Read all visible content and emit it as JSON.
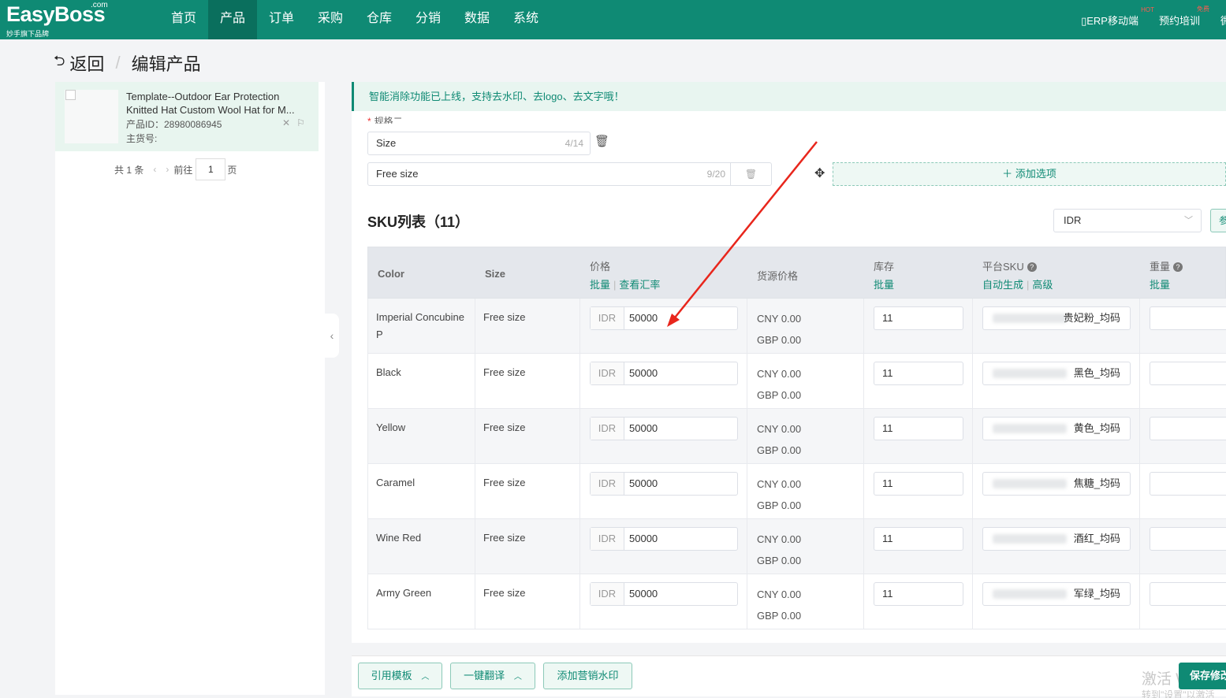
{
  "brand": {
    "name": "EasyBoss",
    "com": ".com",
    "sub": "妙手旗下品牌"
  },
  "nav": [
    {
      "label": "首页",
      "active": false
    },
    {
      "label": "产品",
      "active": true
    },
    {
      "label": "订单",
      "active": false
    },
    {
      "label": "采购",
      "active": false
    },
    {
      "label": "仓库",
      "active": false
    },
    {
      "label": "分销",
      "active": false
    },
    {
      "label": "数据",
      "active": false
    },
    {
      "label": "系统",
      "active": false
    }
  ],
  "top_right": {
    "erp_mobile": "ERP移动端",
    "erp_badge": "HOT",
    "training": "预约培训",
    "training_badge": "免费",
    "edge": "微"
  },
  "header": {
    "back": "返回",
    "sep": "/",
    "title": "编辑产品"
  },
  "left": {
    "product": {
      "title": "Template--Outdoor Ear Protection Knitted Hat Custom Wool Hat for M...",
      "id": "产品ID：28980086945",
      "sku": "主货号:"
    },
    "pager": {
      "total": "共 1 条",
      "goto": "前往",
      "page": "1",
      "unit": "页"
    }
  },
  "notice": "智能消除功能已上线，支持去水印、去logo、去文字哦！",
  "spec": {
    "label": "规格二",
    "name_value": "Size",
    "name_count": "4/14",
    "option_value": "Free size",
    "option_count": "9/20",
    "add_option": "添加选项"
  },
  "sku": {
    "title": "SKU列表（11）",
    "currency": "IDR",
    "edge_btn": "参",
    "headers": {
      "color": "Color",
      "size": "Size",
      "price": "价格",
      "price_batch": "批量",
      "price_rate": "查看汇率",
      "source_price": "货源价格",
      "stock": "库存",
      "stock_batch": "批量",
      "platform_sku": "平台SKU",
      "psku_auto": "自动生成",
      "psku_adv": "高级",
      "weight": "重量",
      "weight_batch": "批量"
    },
    "rows": [
      {
        "color": "Imperial Concubine P",
        "size": "Free size",
        "currency": "IDR",
        "price": "50000",
        "cny": "CNY 0.00",
        "gbp": "GBP 0.00",
        "stock": "11",
        "psku": "贵妃粉_均码"
      },
      {
        "color": "Black",
        "size": "Free size",
        "currency": "IDR",
        "price": "50000",
        "cny": "CNY 0.00",
        "gbp": "GBP 0.00",
        "stock": "11",
        "psku": "黑色_均码"
      },
      {
        "color": "Yellow",
        "size": "Free size",
        "currency": "IDR",
        "price": "50000",
        "cny": "CNY 0.00",
        "gbp": "GBP 0.00",
        "stock": "11",
        "psku": "黄色_均码"
      },
      {
        "color": "Caramel",
        "size": "Free size",
        "currency": "IDR",
        "price": "50000",
        "cny": "CNY 0.00",
        "gbp": "GBP 0.00",
        "stock": "11",
        "psku": "焦糖_均码"
      },
      {
        "color": "Wine Red",
        "size": "Free size",
        "currency": "IDR",
        "price": "50000",
        "cny": "CNY 0.00",
        "gbp": "GBP 0.00",
        "stock": "11",
        "psku": "酒红_均码"
      },
      {
        "color": "Army Green",
        "size": "Free size",
        "currency": "IDR",
        "price": "50000",
        "cny": "CNY 0.00",
        "gbp": "GBP 0.00",
        "stock": "11",
        "psku": "军绿_均码"
      }
    ]
  },
  "bottom": {
    "template": "引用模板",
    "translate": "一键翻译",
    "watermark": "添加营销水印",
    "save": "保存修改",
    "activate": "激活 W",
    "activate_hint": "转到\"设置\"以激活"
  },
  "colors": {
    "brand": "#0f8a74",
    "annotation": "#e8261c"
  }
}
